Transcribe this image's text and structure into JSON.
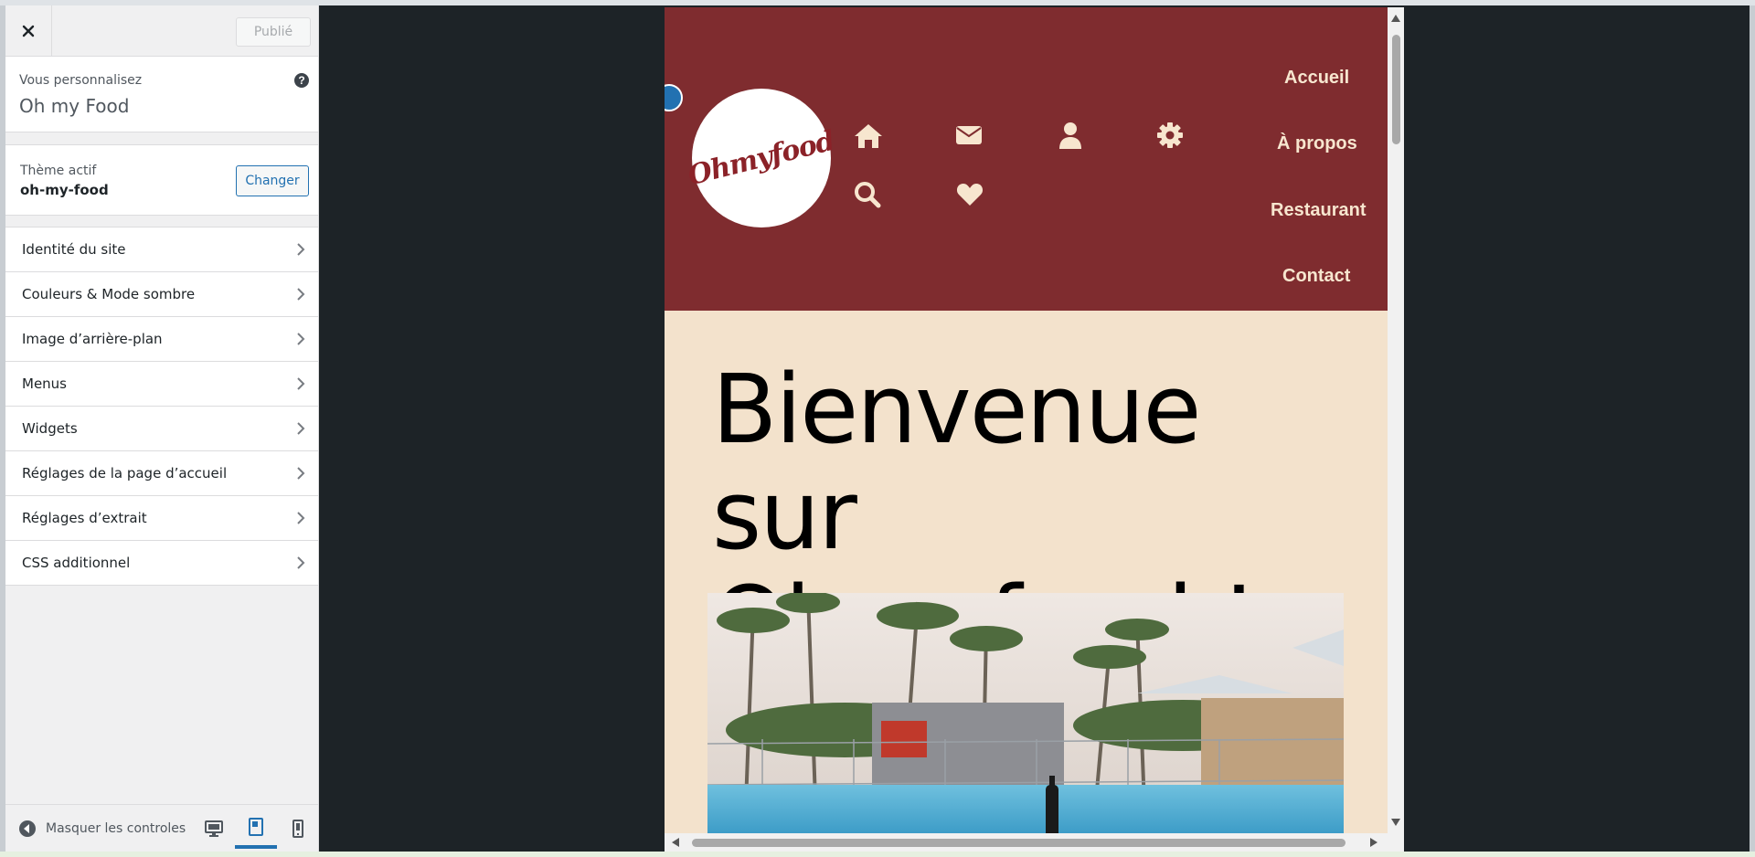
{
  "header": {
    "publish_label": "Publié"
  },
  "customizing": {
    "subtitle": "Vous personnalisez",
    "site_name": "Oh my Food"
  },
  "theme": {
    "label": "Thème actif",
    "name": "oh-my-food",
    "change_label": "Changer"
  },
  "menu": {
    "items": [
      {
        "label": "Identité du site"
      },
      {
        "label": "Couleurs & Mode sombre"
      },
      {
        "label": "Image d’arrière-plan"
      },
      {
        "label": "Menus"
      },
      {
        "label": "Widgets"
      },
      {
        "label": "Réglages de la page d’accueil"
      },
      {
        "label": "Réglages d’extrait"
      },
      {
        "label": "CSS additionnel"
      }
    ]
  },
  "footer": {
    "hide_controls_label": "Masquer les controles",
    "active_device": "tablet"
  },
  "site": {
    "logo_text": "Ohmyfood",
    "nav": [
      "Accueil",
      "À propos",
      "Restaurant",
      "Contact"
    ],
    "heading_line1": "Bienvenue sur",
    "heading_line2": "Ohmyfood !",
    "header_icons": [
      "home-icon",
      "envelope-icon",
      "user-icon",
      "gear-icon",
      "search-icon",
      "heart-icon"
    ]
  },
  "colors": {
    "header_bg": "#7f2c2f",
    "site_bg": "#f3e2cc",
    "accent": "#2271b1",
    "icon": "#f7e6cf"
  }
}
